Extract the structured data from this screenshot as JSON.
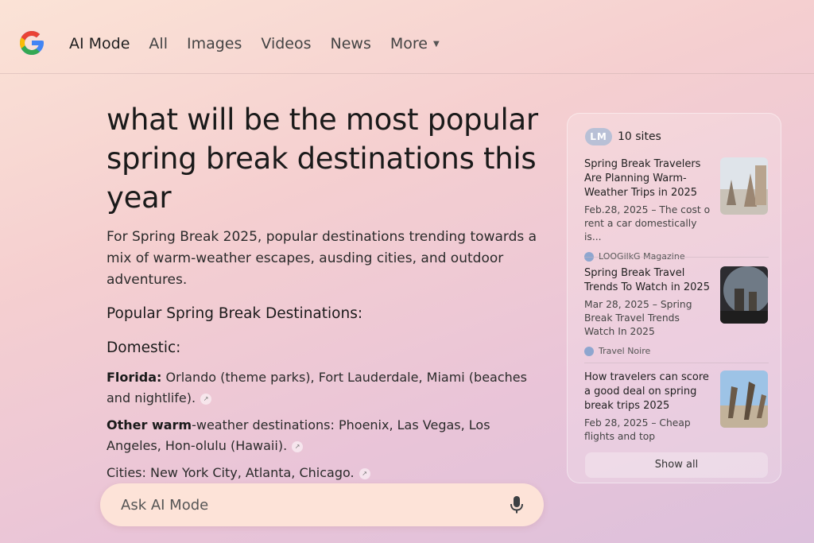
{
  "header": {
    "tabs": [
      {
        "label": "AI Mode"
      },
      {
        "label": "All"
      },
      {
        "label": "Images"
      },
      {
        "label": "Videos"
      },
      {
        "label": "News"
      },
      {
        "label": "More"
      }
    ]
  },
  "main": {
    "query": "what will be the most popular spring break destinations this year",
    "intro": "For Spring Break 2025, popular destinations trending towards a mix of warm-weather escapes, ausding cities, and outdoor adventures.",
    "heading_popular": "Popular Spring Break Destinations:",
    "heading_domestic": "Domestic:",
    "entries": [
      {
        "label": "Florida:",
        "text": "Orlando (theme parks), Fort Lauderdale, Miami (beaches and nightlife)."
      },
      {
        "label": "Other warm",
        "text": "-weather destinations: Phoenix, Las Vegas, Los Angeles, Hon-olulu (Hawaii)."
      },
      {
        "label": "",
        "text": "Cities: New York City, Atlanta, Chicago."
      }
    ]
  },
  "sources": {
    "badge": "LM",
    "count_label": "10 sites",
    "cards": [
      {
        "title": "Spring Break Travelers Are Planning Warm-Weather Trips in 2025",
        "snippet": "Feb.28, 2025 – The cost o rent a car domestically is...",
        "source": "LOOGilkG Magazine"
      },
      {
        "title": "Spring Break Travel Trends To Watch in 2025",
        "snippet": "Mar 28, 2025 – Spring Break Travel Trends Watch In 2025",
        "source": "Travel Noire"
      },
      {
        "title": "How travelers can score a good deal on spring break trips 2025",
        "snippet": "Feb 28, 2025 – Cheap flights and top",
        "source": ""
      }
    ],
    "show_all": "Show all"
  },
  "ask": {
    "placeholder": "Ask AI Mode"
  }
}
